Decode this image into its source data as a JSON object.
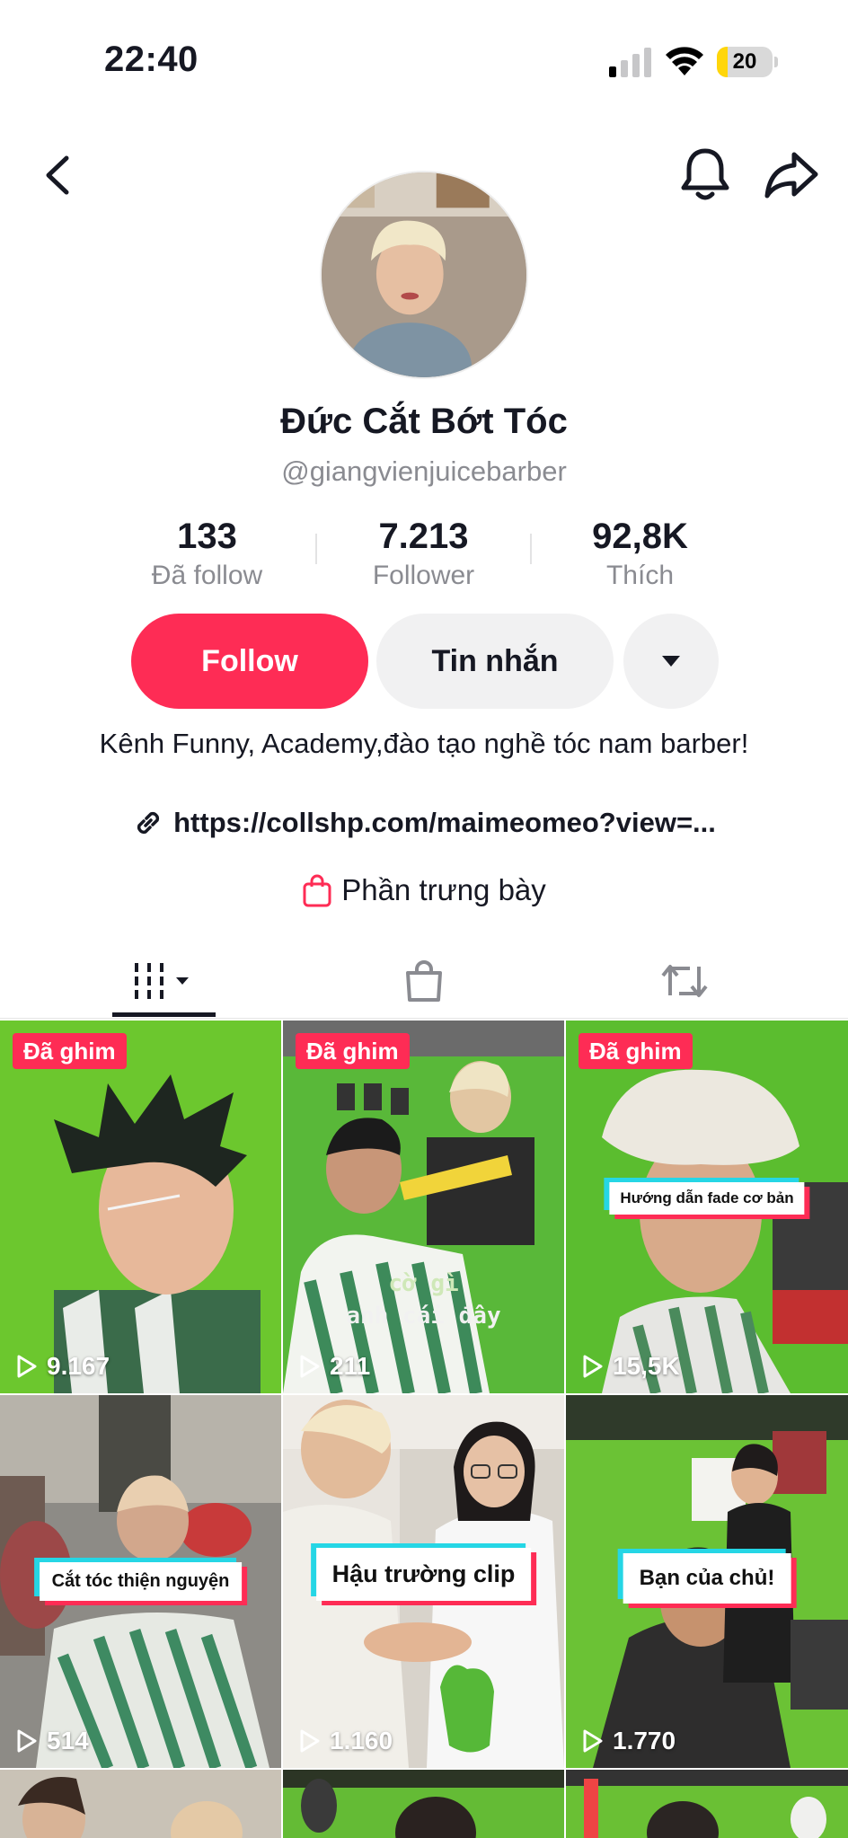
{
  "status_bar": {
    "time": "22:40",
    "battery": "20",
    "battery_level": 0.2
  },
  "nav": {
    "back_icon": "chevron-left-icon",
    "bell_icon": "bell-icon",
    "share_icon": "share-arrow-icon"
  },
  "profile": {
    "display_name": "Đức Cắt Bớt Tóc",
    "username": "@giangvienjuicebarber",
    "stats": [
      {
        "value": "133",
        "label": "Đã follow"
      },
      {
        "value": "7.213",
        "label": "Follower"
      },
      {
        "value": "92,8K",
        "label": "Thích"
      }
    ],
    "follow_label": "Follow",
    "message_label": "Tin nhắn",
    "bio": "Kênh Funny, Academy,đào tạo nghề tóc nam barber!",
    "link": "https://collshp.com/maimeomeo?view=...",
    "showcase": "Phần trưng bày"
  },
  "colors": {
    "accent": "#fe2c55",
    "secondary_button": "#f1f1f2",
    "muted_text": "#8a8b91"
  },
  "tabs": [
    "videos-grid-icon",
    "shopping-bag-icon",
    "repost-icon"
  ],
  "videos": [
    {
      "pinned": "Đã ghim",
      "views": "9.167"
    },
    {
      "pinned": "Đã ghim",
      "views": "211",
      "subtitle1": "cờ gì",
      "subtitle2": "anh cái đây"
    },
    {
      "pinned": "Đã ghim",
      "views": "15,5K",
      "caption": "Hướng dẫn fade cơ bản"
    },
    {
      "views": "514",
      "caption": "Cắt tóc thiện nguyện"
    },
    {
      "views": "1.160",
      "caption": "Hậu trường clip"
    },
    {
      "views": "1.770",
      "caption": "Bạn của chủ!"
    }
  ]
}
